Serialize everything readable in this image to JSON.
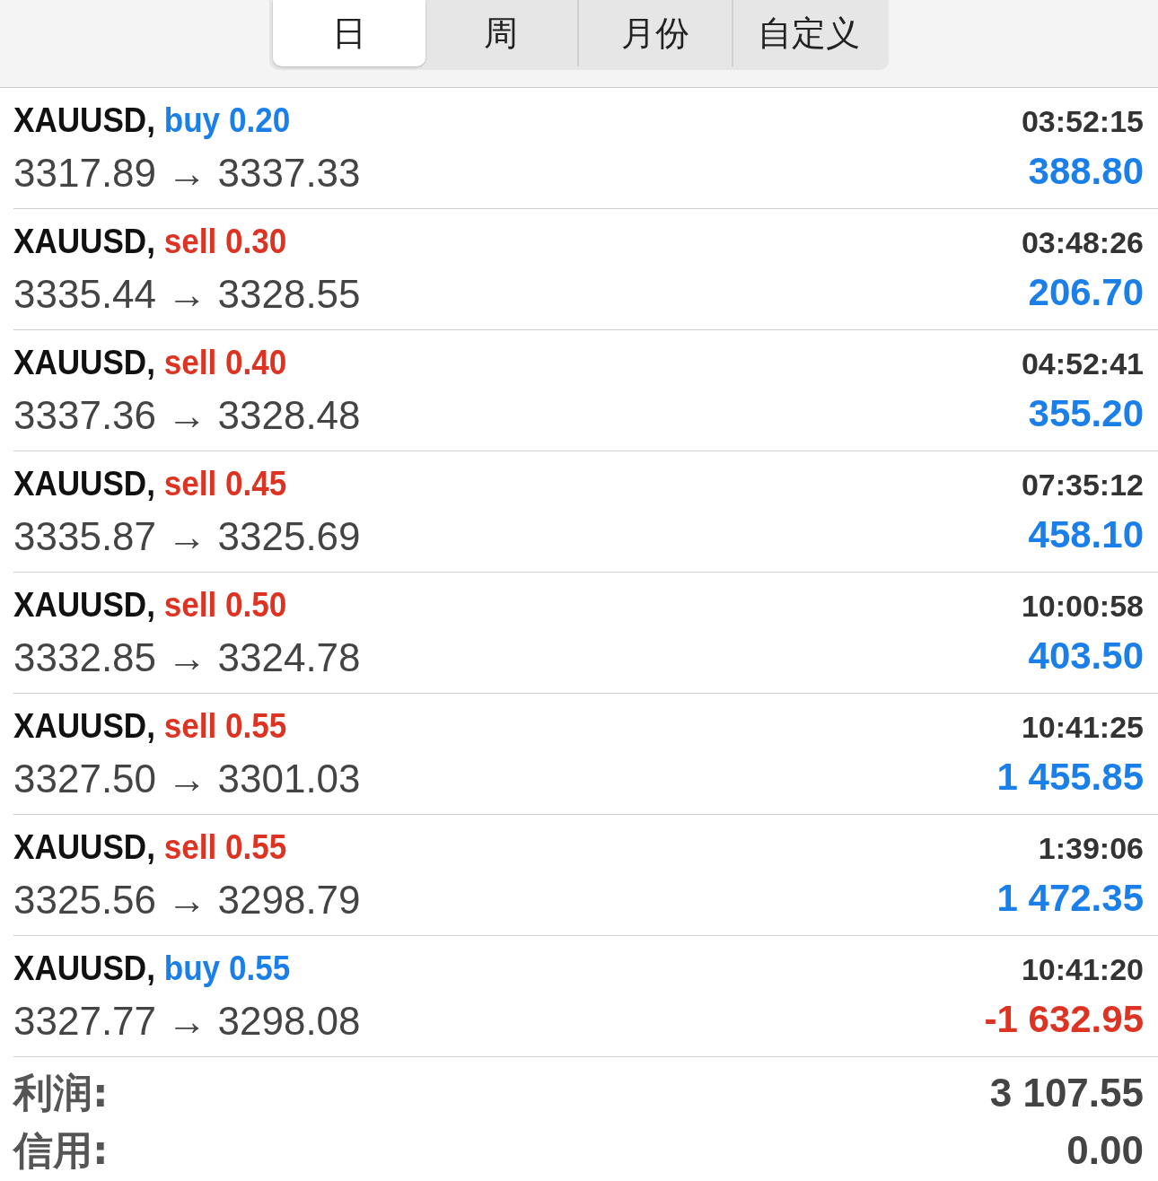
{
  "tabs": [
    {
      "label": "日",
      "selected": true
    },
    {
      "label": "周",
      "selected": false
    },
    {
      "label": "月份",
      "selected": false
    },
    {
      "label": "自定义",
      "selected": false
    }
  ],
  "trades": [
    {
      "symbol": "XAUUSD,",
      "kind": "buy",
      "volume": "buy 0.20",
      "prices": "3317.89 → 3337.33",
      "time": "03:52:15",
      "profit": "388.80",
      "loss": false
    },
    {
      "symbol": "XAUUSD,",
      "kind": "sell",
      "volume": "sell 0.30",
      "prices": "3335.44 → 3328.55",
      "time": "03:48:26",
      "profit": "206.70",
      "loss": false
    },
    {
      "symbol": "XAUUSD,",
      "kind": "sell",
      "volume": "sell 0.40",
      "prices": "3337.36 → 3328.48",
      "time": "04:52:41",
      "profit": "355.20",
      "loss": false
    },
    {
      "symbol": "XAUUSD,",
      "kind": "sell",
      "volume": "sell 0.45",
      "prices": "3335.87 → 3325.69",
      "time": "07:35:12",
      "profit": "458.10",
      "loss": false
    },
    {
      "symbol": "XAUUSD,",
      "kind": "sell",
      "volume": "sell 0.50",
      "prices": "3332.85 → 3324.78",
      "time": "10:00:58",
      "profit": "403.50",
      "loss": false
    },
    {
      "symbol": "XAUUSD,",
      "kind": "sell",
      "volume": "sell 0.55",
      "prices": "3327.50 → 3301.03",
      "time": "10:41:25",
      "profit": "1 455.85",
      "loss": false
    },
    {
      "symbol": "XAUUSD,",
      "kind": "sell",
      "volume": "sell 0.55",
      "prices": "3325.56 → 3298.79",
      "time": "1:39:06",
      "profit": "1 472.35",
      "loss": false
    },
    {
      "symbol": "XAUUSD,",
      "kind": "buy",
      "volume": "buy 0.55",
      "prices": "3327.77 → 3298.08",
      "time": "10:41:20",
      "profit": "-1 632.95",
      "loss": true
    }
  ],
  "summary": [
    {
      "label": "利润:",
      "value": "3 107.55"
    },
    {
      "label": "信用:",
      "value": "0.00"
    }
  ]
}
